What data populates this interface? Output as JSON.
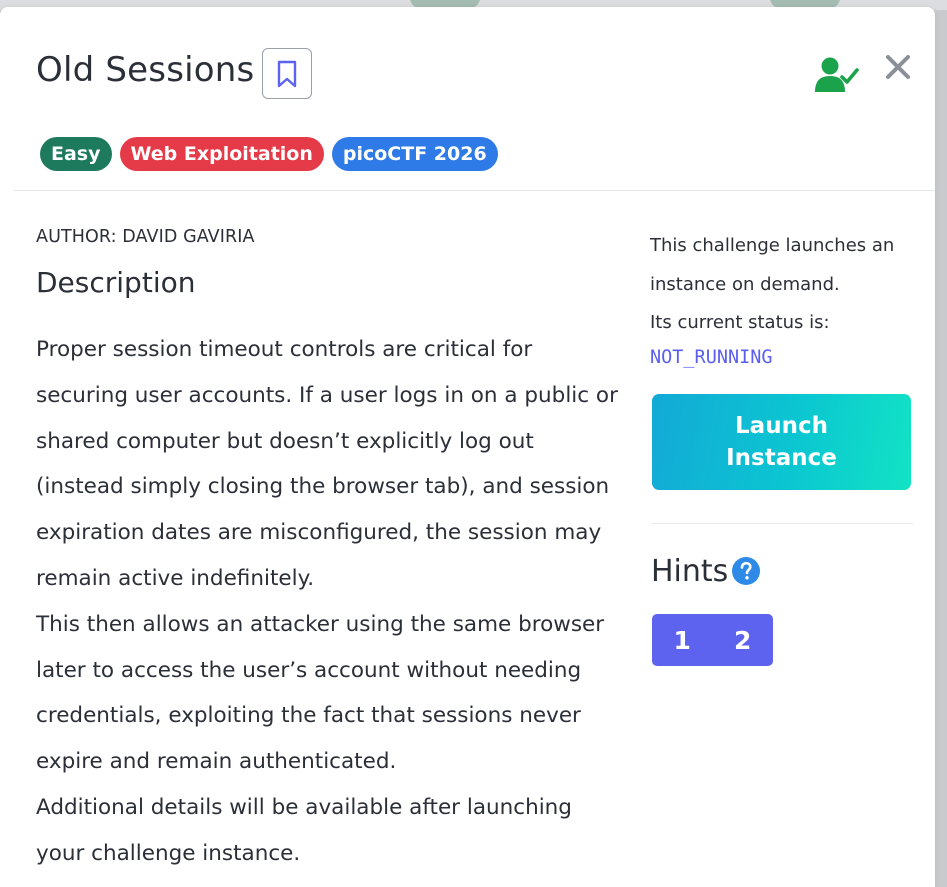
{
  "challenge": {
    "title": "Old Sessions",
    "author": "AUTHOR: DAVID GAVIRIA",
    "tags": [
      {
        "label": "Easy",
        "color": "#1e7a5c"
      },
      {
        "label": "Web Exploitation",
        "color": "#e53a48"
      },
      {
        "label": "picoCTF 2026",
        "color": "#2e7ae6"
      }
    ],
    "description_heading": "Description",
    "description_paragraphs": [
      "Proper session timeout controls are critical for securing user accounts. If a user logs in on a public or shared computer but doesn’t explicitly log out (instead simply closing the browser tab), and session expiration dates are misconfigured, the session may remain active indefinitely.",
      "This then allows an attacker using the same browser later to access the user’s account without needing credentials, exploiting the fact that sessions never expire and remain authenticated.",
      "Additional details will be available after launching your challenge instance."
    ]
  },
  "instance": {
    "info_line1": "This challenge launches an instance on demand.",
    "info_line2": "Its current status is:",
    "status": "NOT_RUNNING",
    "launch_label_line1": "Launch",
    "launch_label_line2": "Instance"
  },
  "hints": {
    "heading": "Hints",
    "buttons": [
      "1",
      "2"
    ]
  },
  "icons": {
    "bookmark": "bookmark-icon",
    "solved_user": "user-check-icon",
    "close": "close-icon",
    "help": "question-circle-icon"
  },
  "colors": {
    "accent": "#5d63ef",
    "status": "#5b5ff0",
    "solved_green": "#1aa34a"
  }
}
